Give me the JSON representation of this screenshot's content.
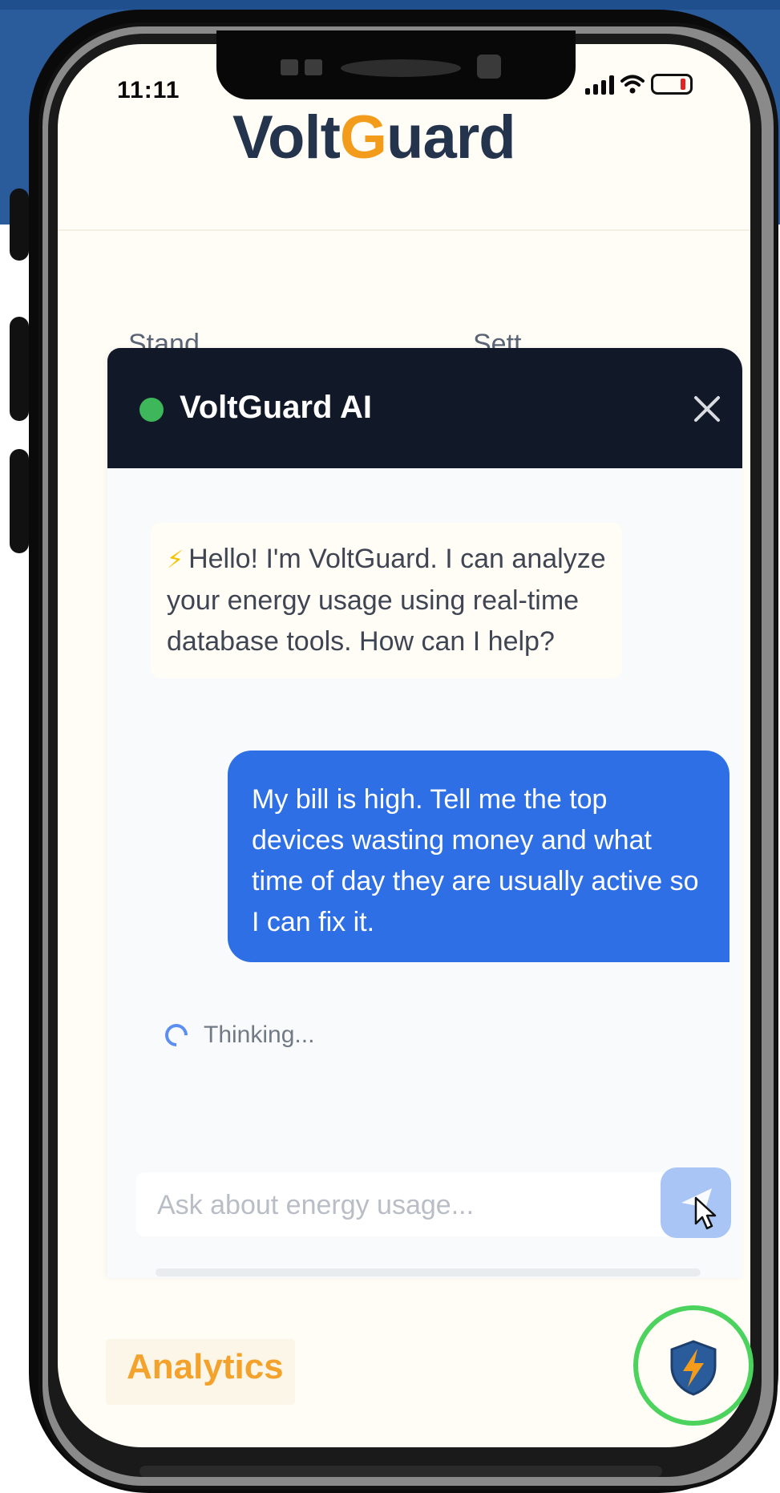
{
  "status_bar": {
    "time": "11:11",
    "battery_level": 0.15,
    "battery_color": "#e02424"
  },
  "header": {
    "brand_start": "Volt",
    "brand_bolt": "G",
    "brand_end": "uard",
    "brand_color": "#24344d",
    "bolt_color": "#f39c1b"
  },
  "background_cards": {
    "left_label": "Stand",
    "right_label": "Sett"
  },
  "chat": {
    "title": "VoltGuard AI",
    "online_color": "#3eb65a",
    "close_icon": "close-icon",
    "messages": [
      {
        "role": "assistant",
        "icon": "zap-icon",
        "text": "Hello! I'm VoltGuard. I can analyze your energy usage using real-time database tools. How can I help?"
      },
      {
        "role": "user",
        "text": "My bill is high. Tell me the top devices wasting money and what time of day they are usually active so I can fix it."
      }
    ],
    "thinking_label": "Thinking...",
    "input": {
      "placeholder": "Ask about energy usage...",
      "value": ""
    },
    "send_icon": "send-icon",
    "user_bubble_color": "#2e6fe6"
  },
  "bottom_nav": {
    "analytics_label": "Analytics",
    "fab_icon": "shield-bolt-icon",
    "fab_ring_color": "#4cd35e"
  }
}
